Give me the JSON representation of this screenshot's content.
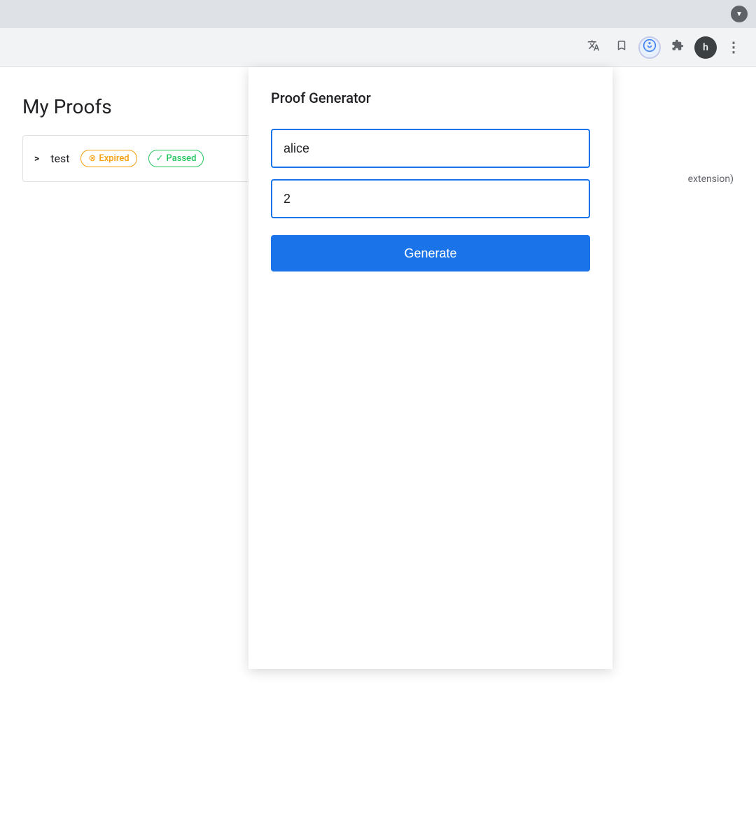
{
  "chrome": {
    "top_bar": {
      "dropdown_icon": "▼"
    },
    "toolbar": {
      "translate_icon": "🌐",
      "bookmark_icon": "☆",
      "extension_icon": "⊕",
      "puzzle_icon": "🧩",
      "avatar_label": "h",
      "more_icon": "⋮"
    }
  },
  "background_page": {
    "title": "My Proofs",
    "extension_text": "extension)",
    "proof_row": {
      "chevron": ">",
      "name": "test",
      "badge_expired_label": "Expired",
      "badge_passed_label": "Passed"
    }
  },
  "popup": {
    "title": "Proof Generator",
    "name_input_value": "alice",
    "name_input_placeholder": "alice",
    "number_input_value": "2",
    "number_input_placeholder": "",
    "generate_button_label": "Generate"
  }
}
